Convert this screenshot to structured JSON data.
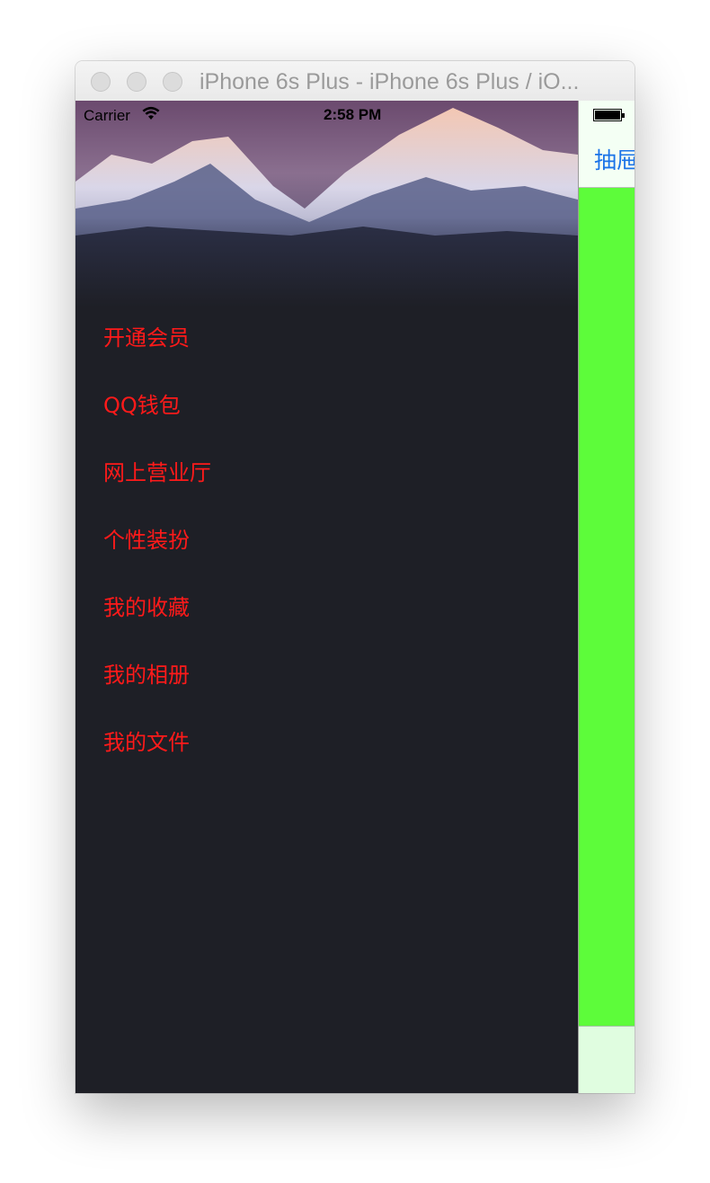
{
  "window": {
    "title": "iPhone 6s Plus - iPhone 6s Plus / iO..."
  },
  "status_bar": {
    "carrier": "Carrier",
    "time": "2:58 PM",
    "wifi_icon": "wifi-icon",
    "battery_icon": "battery-icon"
  },
  "drawer": {
    "menu_items": [
      {
        "label": "开通会员"
      },
      {
        "label": "QQ钱包"
      },
      {
        "label": "网上营业厅"
      },
      {
        "label": "个性装扮"
      },
      {
        "label": "我的收藏"
      },
      {
        "label": "我的相册"
      },
      {
        "label": "我的文件"
      }
    ],
    "menu_color": "#ff1a1a",
    "background_color": "#1e1f26"
  },
  "main": {
    "nav_button_label": "抽屉",
    "content_color": "#5dfc3a",
    "nav_button_color": "#1b73e8"
  }
}
